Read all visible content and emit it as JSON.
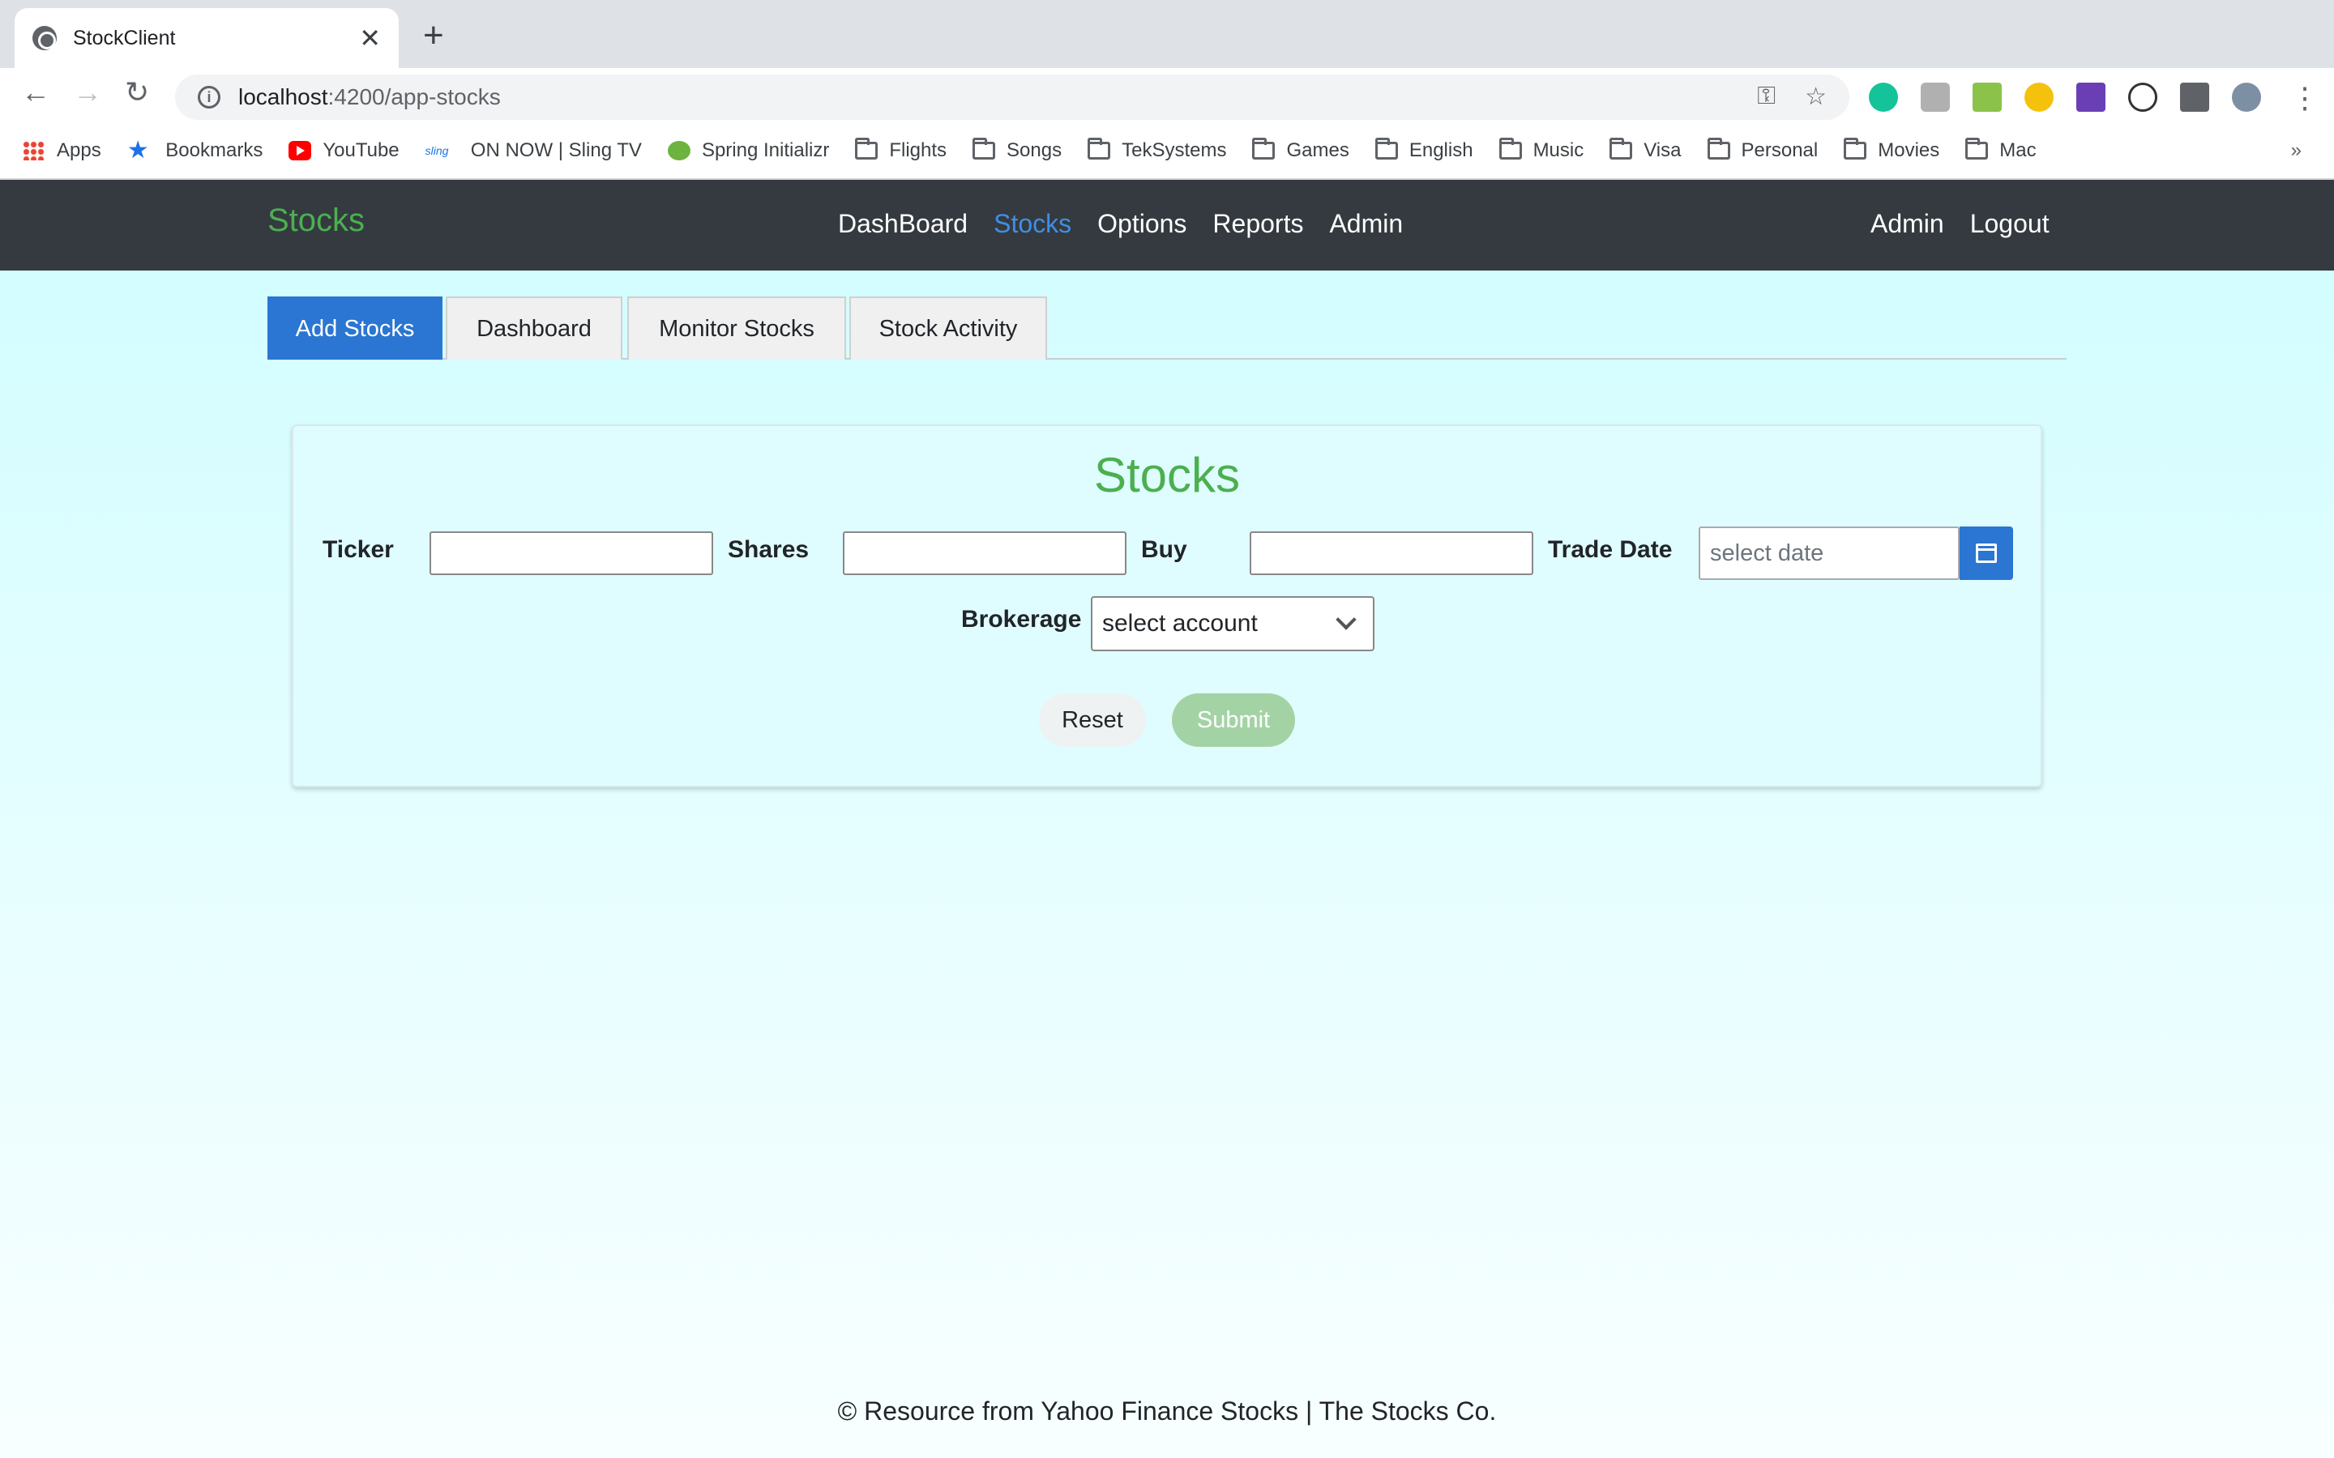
{
  "browser": {
    "tab_title": "StockClient",
    "url_host": "localhost",
    "url_path": ":4200/app-stocks",
    "bookmarks": [
      "Apps",
      "Bookmarks",
      "YouTube",
      "ON NOW | Sling TV",
      "Spring Initializr",
      "Flights",
      "Songs",
      "TekSystems",
      "Games",
      "English",
      "Music",
      "Visa",
      "Personal",
      "Movies",
      "Mac"
    ],
    "sling_badge": "sling"
  },
  "app": {
    "brand": "Stocks",
    "nav": [
      "DashBoard",
      "Stocks",
      "Options",
      "Reports",
      "Admin"
    ],
    "active_nav": "Stocks",
    "right_nav": [
      "Admin",
      "Logout"
    ]
  },
  "tabs": [
    "Add Stocks",
    "Dashboard",
    "Monitor Stocks",
    "Stock Activity"
  ],
  "form": {
    "title": "Stocks",
    "ticker_label": "Ticker",
    "ticker_value": "",
    "shares_label": "Shares",
    "shares_value": "",
    "buy_label": "Buy",
    "buy_value": "",
    "trade_date_label": "Trade Date",
    "trade_date_placeholder": "select date",
    "brokerage_label": "Brokerage",
    "brokerage_selected": "select account",
    "reset_label": "Reset",
    "submit_label": "Submit"
  },
  "footer": "© Resource from Yahoo Finance Stocks | The Stocks Co.",
  "colors": {
    "brand": "#4caf50",
    "navbar": "#343a40",
    "active_nav": "#3f8fe5",
    "primary": "#2a76d2",
    "submit_disabled": "#a3d3a5"
  }
}
